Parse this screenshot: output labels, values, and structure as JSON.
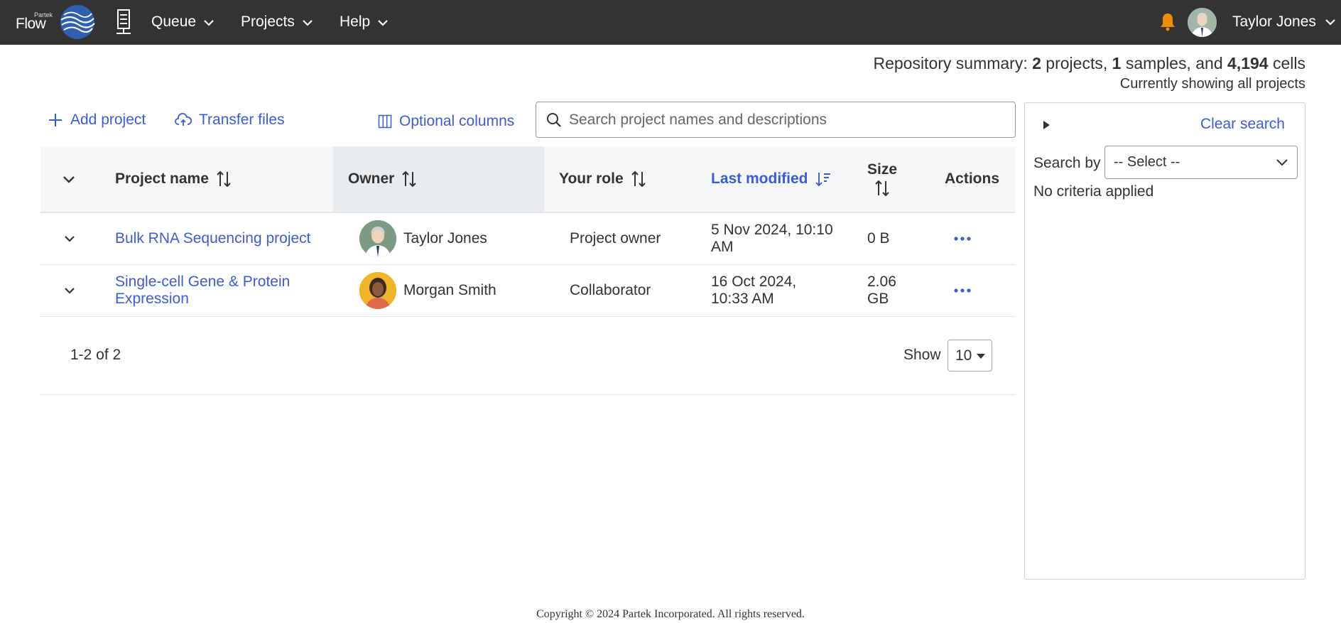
{
  "nav": {
    "brand_small": "Partek",
    "brand": "Flow",
    "menus": [
      {
        "label": "Queue"
      },
      {
        "label": "Projects"
      },
      {
        "label": "Help"
      }
    ],
    "user_name": "Taylor Jones"
  },
  "summary": {
    "prefix": "Repository summary: ",
    "projects_count": "2",
    "projects_word": " projects, ",
    "samples_count": "1",
    "samples_word": " samples, and ",
    "cells_count": "4,194",
    "cells_word": " cells",
    "subtitle": "Currently showing all projects"
  },
  "toolbar": {
    "add_project": "Add project",
    "transfer_files": "Transfer files",
    "optional_columns": "Optional columns",
    "search_placeholder": "Search project names and descriptions"
  },
  "table": {
    "columns": {
      "project_name": "Project name",
      "owner": "Owner",
      "your_role": "Your role",
      "last_modified": "Last modified",
      "size": "Size",
      "actions": "Actions"
    },
    "rows": [
      {
        "name": "Bulk RNA Sequencing project",
        "owner": "Taylor Jones",
        "role": "Project owner",
        "modified_line1": "5 Nov 2024, 10:10",
        "modified_line2": "AM",
        "size_line1": "0 B",
        "size_line2": ""
      },
      {
        "name_line1": "Single-cell Gene & Protein",
        "name_line2": "Expression",
        "owner": "Morgan Smith",
        "role": "Collaborator",
        "modified_line1": "16 Oct 2024,",
        "modified_line2": "10:33 AM",
        "size_line1": "2.06",
        "size_line2": "GB"
      }
    ],
    "pager": {
      "range": "1-2 of 2",
      "show_label": "Show",
      "page_size": "10"
    }
  },
  "panel": {
    "clear_search": "Clear search",
    "search_by_label": "Search by",
    "search_by_value": "-- Select --",
    "no_criteria": "No criteria applied"
  },
  "footer": {
    "copyright": "Copyright © 2024 Partek Incorporated. All rights reserved."
  },
  "colors": {
    "topbar": "#333333",
    "link": "#3b5bdb",
    "bell": "#f08c00"
  }
}
